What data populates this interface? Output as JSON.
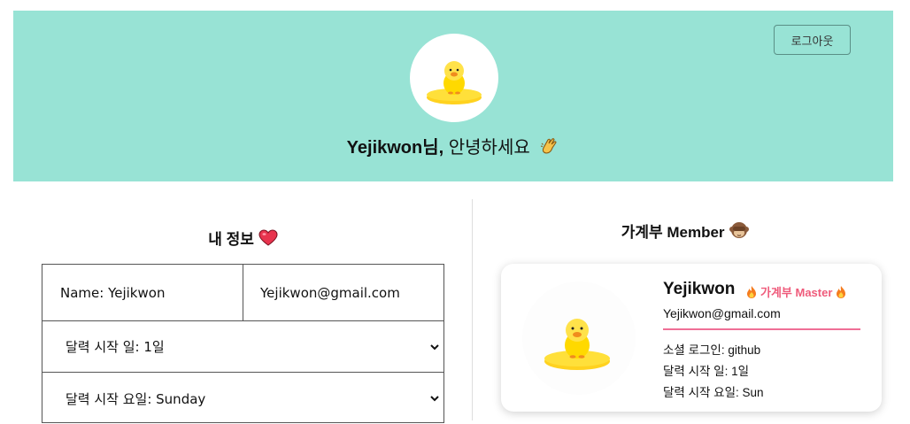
{
  "header": {
    "logout_label": "로그아웃",
    "greeting_name": "Yejikwon님,",
    "greeting_text": " 안녕하세요",
    "bg_color": "#98e3d5"
  },
  "my_info": {
    "title": "내 정보",
    "name_text": "Name: Yejikwon",
    "email_text": "Yejikwon@gmail.com",
    "calendar_start_day": "달력 시작 일: 1일",
    "calendar_start_weekday": "달력 시작 요일: Sunday"
  },
  "members": {
    "title": "가계부 Member",
    "card": {
      "name": "Yejikwon",
      "badge": "가계부 Master",
      "email": "Yejikwon@gmail.com",
      "social_login": "소셜 로그인: github",
      "start_day": "달력 시작 일: 1일",
      "start_weekday": "달력 시작 요일: Sun",
      "accent_color": "#ef5b7b"
    }
  }
}
